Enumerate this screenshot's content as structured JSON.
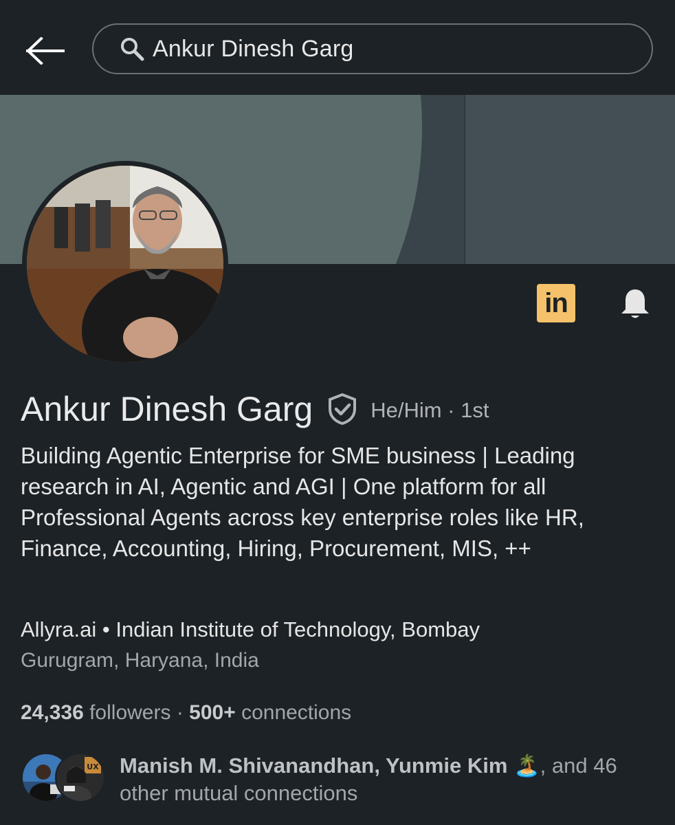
{
  "search": {
    "query": "Ankur Dinesh Garg"
  },
  "icons": {
    "back": "arrow-left-icon",
    "search": "search-icon",
    "linkedin": "linkedin-logo-icon",
    "bell": "bell-icon",
    "verified": "verified-shield-icon"
  },
  "profile": {
    "name": "Ankur Dinesh Garg",
    "pronoun_degree": "He/Him · 1st",
    "headline": "Building Agentic Enterprise for SME business | Leading research in AI, Agentic and AGI | One platform for all Professional Agents across key enterprise roles like HR, Finance, Accounting, Hiring, Procurement, MIS, ++",
    "company": "Allyra.ai",
    "separator": " • ",
    "school": "Indian Institute of Technology, Bombay",
    "location": "Gurugram, Haryana, India"
  },
  "stats": {
    "followers_count": "24,336",
    "followers_label": " followers",
    "dot": " · ",
    "connections_count": "500+",
    "connections_label": " connections"
  },
  "mutual": {
    "names": "Manish M. Shivanandhan, Yunmie Kim",
    "emoji": " 🏝️",
    "suffix": ", and 46 other mutual connections"
  },
  "linkedin_badge_text": "in",
  "colors": {
    "background": "#1d2226",
    "cover_accent": "#5b6b6b",
    "linkedin_badge": "#f5c26b"
  }
}
